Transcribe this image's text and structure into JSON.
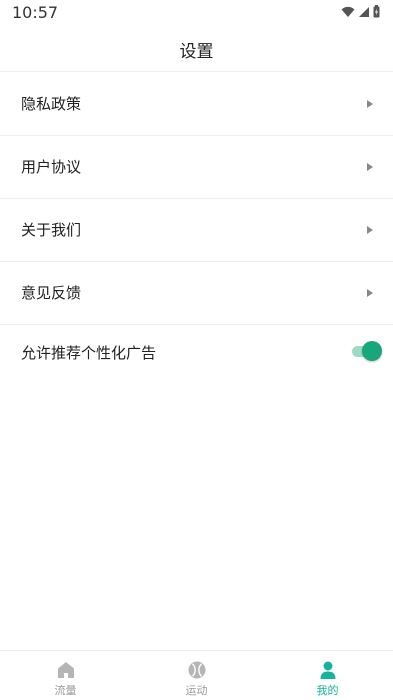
{
  "status_bar": {
    "time": "10:57",
    "icons": [
      "wifi-icon",
      "cellular-signal-icon",
      "battery-icon"
    ]
  },
  "header": {
    "title": "设置"
  },
  "settings": {
    "items": [
      {
        "label": "隐私政策",
        "icon": "chevron-right-icon"
      },
      {
        "label": "用户协议",
        "icon": "chevron-right-icon"
      },
      {
        "label": "关于我们",
        "icon": "chevron-right-icon"
      },
      {
        "label": "意见反馈",
        "icon": "chevron-right-icon"
      }
    ],
    "toggle": {
      "label": "允许推荐个性化广告",
      "state": "on"
    }
  },
  "tab_bar": {
    "tabs": [
      {
        "label": "流量",
        "icon": "home-icon",
        "active": false
      },
      {
        "label": "运动",
        "icon": "baseball-icon",
        "active": false
      },
      {
        "label": "我的",
        "icon": "person-icon",
        "active": true
      }
    ]
  },
  "colors": {
    "accent": "#17a77a",
    "accent_light": "#9fdbc4",
    "active_tab": "#17b29a",
    "inactive_tab": "#999999",
    "divider": "#ececec"
  }
}
